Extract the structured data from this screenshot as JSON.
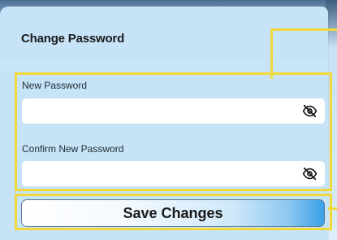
{
  "dialog": {
    "title": "Change Password"
  },
  "fields": {
    "new_password": {
      "label": "New Password",
      "value": "",
      "placeholder": "",
      "visibility_icon": "eye-off-icon"
    },
    "confirm_password": {
      "label": "Confirm New Password",
      "value": "",
      "placeholder": "",
      "visibility_icon": "eye-off-icon"
    }
  },
  "actions": {
    "save_label": "Save Changes"
  },
  "colors": {
    "panel_background": "#c6e3f7",
    "highlight_outline": "#f2d93b",
    "button_gradient_end": "#3aa0e6"
  }
}
